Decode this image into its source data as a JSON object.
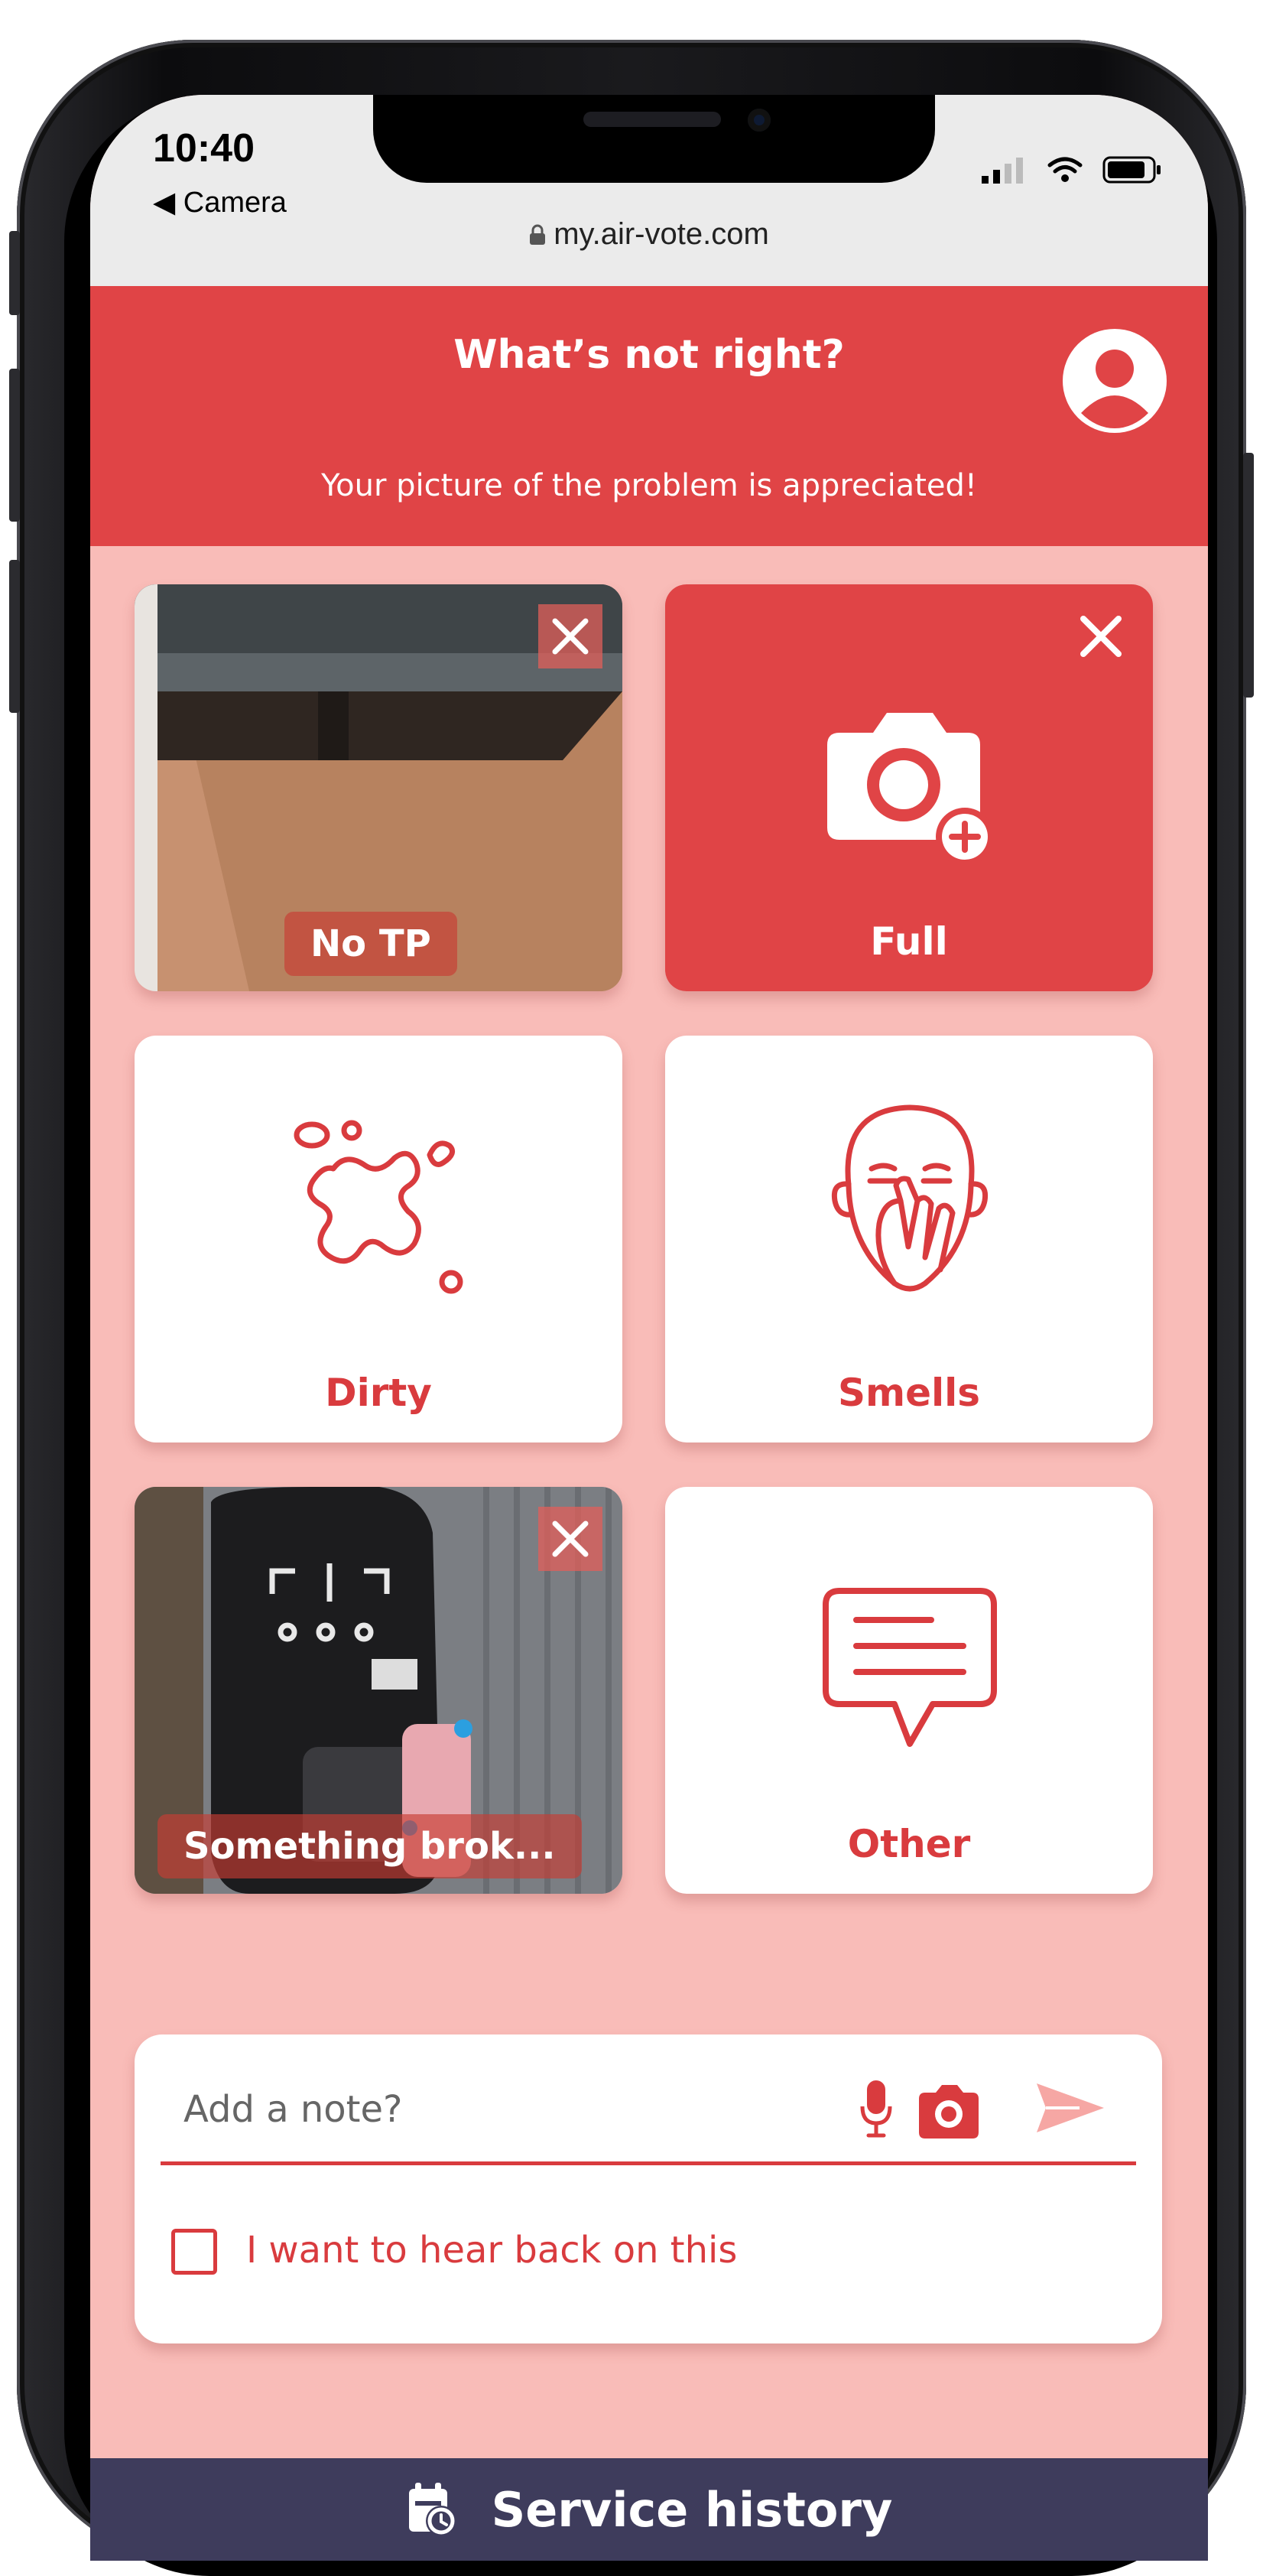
{
  "status_bar": {
    "time": "10:40",
    "back_app": "◀ Camera",
    "url": "my.air-vote.com"
  },
  "header": {
    "title": "What’s not right?",
    "subtitle": "Your picture of the problem is appreciated!",
    "icons": {
      "account": "user-avatar-icon"
    }
  },
  "tiles": [
    {
      "label": "No TP",
      "kind": "photo",
      "selected": true
    },
    {
      "label": "Full",
      "kind": "add-photo",
      "selected": true
    },
    {
      "label": "Dirty",
      "kind": "icon",
      "icon": "splat-icon",
      "selected": false
    },
    {
      "label": "Smells",
      "kind": "icon",
      "icon": "smelling-face-icon",
      "selected": false
    },
    {
      "label": "Something brok...",
      "kind": "photo",
      "selected": true
    },
    {
      "label": "Other",
      "kind": "icon",
      "icon": "speech-bubble-icon",
      "selected": false
    }
  ],
  "note": {
    "placeholder": "Add a note?",
    "checkbox_label": "I want to hear back on this",
    "checkbox_checked": false
  },
  "footer": {
    "label": "Service history"
  },
  "colors": {
    "accent": "#e04446",
    "background": "#f9bcb8",
    "footer": "#3e3c5c"
  }
}
